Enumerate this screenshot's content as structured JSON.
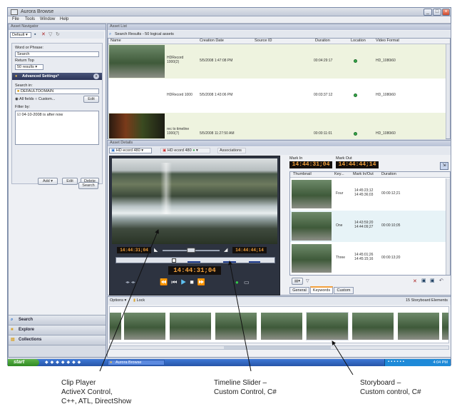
{
  "window": {
    "title": "Aurora Browse"
  },
  "menu": [
    "File",
    "Tools",
    "Window",
    "Help"
  ],
  "navigator": {
    "title": "Asset Navigator",
    "default_label": "Default",
    "word_or_phrase_label": "Word or Phrase:",
    "search_value": "Search",
    "return_top_label": "Return Top",
    "results_value": "50 results",
    "advanced_label": "Advanced Settings*",
    "search_in_label": "Search in:",
    "domain_value": "DEFAULTDOMAIN",
    "edit_label": "Edit",
    "all_fields_label": "All fields",
    "custom_label": "Custom...",
    "filter_by_label": "Filter by:",
    "filter_item": "04-10-2008 is after now",
    "add_label": "Add",
    "edit2_label": "Edit",
    "delete_label": "Delete",
    "search_button": "Search",
    "nav_items": [
      "Search",
      "Explore",
      "Collections"
    ]
  },
  "asset_list": {
    "title": "Asset List",
    "search_results": "Search Results - 50 logical assets",
    "columns": [
      "Name",
      "Creation Date",
      "Source ID",
      "Duration",
      "Location",
      "Video Format"
    ],
    "rows": [
      {
        "name": "HDRecord 1000(2)",
        "date": "5/5/2008 1:47:08 PM",
        "source": "",
        "duration": "00:04:29:17",
        "format": "HD_1080i60"
      },
      {
        "name": "HDRecord 1000",
        "date": "5/5/2008 1:43:06 PM",
        "source": "",
        "duration": "00:03:37:12",
        "format": "HD_1080i60"
      },
      {
        "name": "rec to timeline 1000(7)",
        "date": "5/5/2008 11:27:50 AM",
        "source": "",
        "duration": "00:00:11:01",
        "format": "HD_1080i60"
      }
    ]
  },
  "details": {
    "title": "Asset Details",
    "clip_a": "HD ecord 480",
    "clip_b": "HD ecord 480",
    "associations": "Associations",
    "mark_in_label": "Mark In",
    "mark_out_label": "Mark Out",
    "mark_in_tc": "14:44:31;04",
    "mark_out_tc": "14:44:44;14",
    "player_in_tc": "14:44:31;04",
    "player_out_tc": "14:44:44;14",
    "current_tc": "14:44:31;04",
    "kw_columns": [
      "Thumbnail",
      "Key...",
      "Mark In/Out",
      "Duration"
    ],
    "kw_rows": [
      {
        "key": "Four",
        "in": "14:45:23;12",
        "out": "14:45:36;03",
        "dur": "00:00:12;21"
      },
      {
        "key": "One",
        "in": "14:43:59;20",
        "out": "14:44:09;27",
        "dur": "00:00:10;05"
      },
      {
        "key": "Three",
        "in": "14:45:01;26",
        "out": "14:45:15;16",
        "dur": "00:00:13;20"
      }
    ],
    "tabs": [
      "General",
      "Keywords",
      "Custom"
    ]
  },
  "storyboard": {
    "options_label": "Options",
    "lock_label": "Lock",
    "count_label": "15 Storyboard Elements"
  },
  "taskbar": {
    "start": "start",
    "task": "Aurora Browse",
    "clock": "4:04 PM"
  },
  "annotations": {
    "player": [
      "Clip Player",
      "ActiveX Control,",
      "C++, ATL, DirectShow"
    ],
    "slider": [
      "Timeline Slider –",
      "Custom Control, C#"
    ],
    "storyboard": [
      "Storyboard –",
      "Custom control, C#"
    ]
  }
}
